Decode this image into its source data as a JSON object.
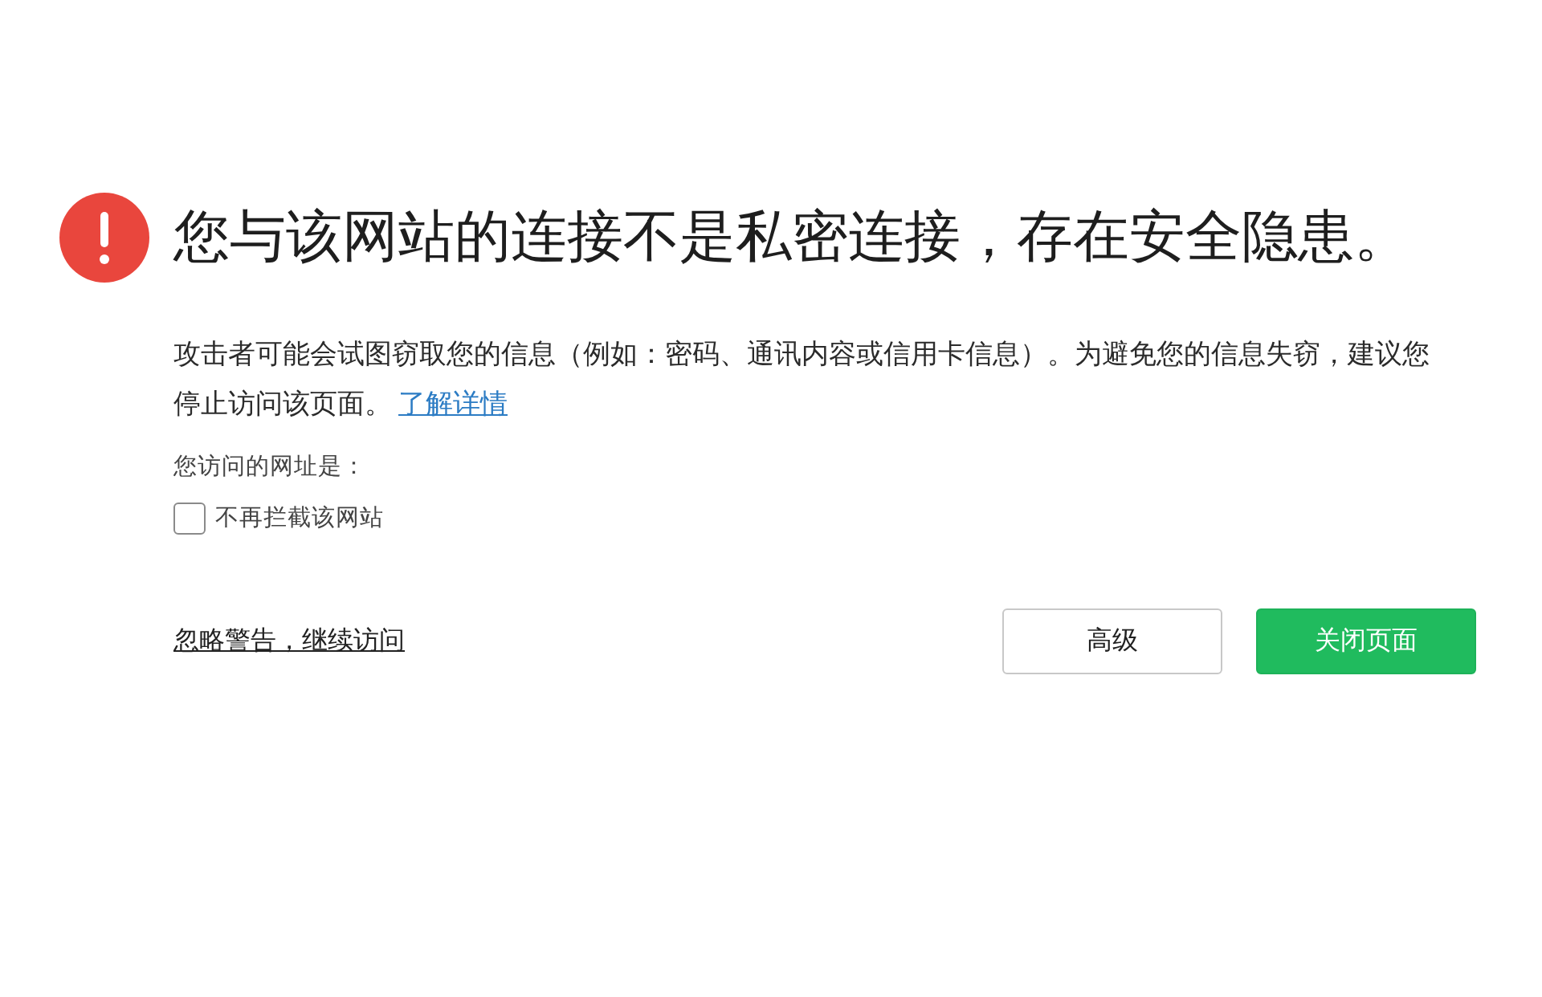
{
  "warning": {
    "title": "您与该网站的连接不是私密连接，存在安全隐患。",
    "description": "攻击者可能会试图窃取您的信息（例如：密码、通讯内容或信用卡信息）。为避免您的信息失窃，建议您停止访问该页面。",
    "learn_more_link": "了解详情"
  },
  "url_label": "您访问的网址是：",
  "options": [
    {
      "kind": "checkbox",
      "label": "不再拦截该网站",
      "checked": false
    }
  ],
  "actions": {
    "ignore_link": "忽略警告，继续访问",
    "buttons": [
      {
        "kind": "secondary",
        "label": "高级"
      },
      {
        "kind": "primary",
        "label": "关闭页面"
      }
    ]
  }
}
